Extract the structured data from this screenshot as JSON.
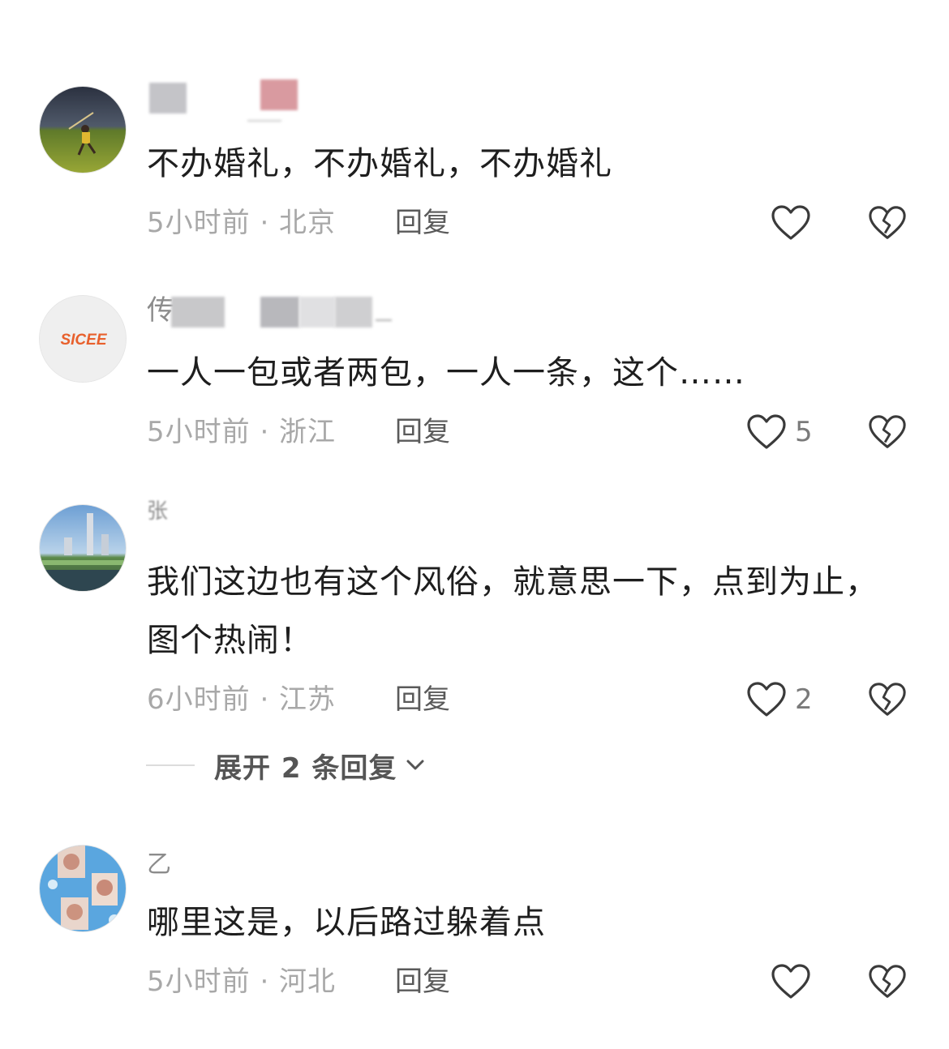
{
  "comments": [
    {
      "username": "",
      "text": "不办婚礼，不办婚礼，不办婚礼",
      "time_location": "5小时前 · 北京",
      "reply_label": "回复",
      "like_count": "",
      "like_icon": "heart-outline-icon",
      "dislike_icon": "broken-heart-icon"
    },
    {
      "username": "传",
      "avatar_text": "SICEE",
      "text": "一人一包或者两包，一人一条，这个……",
      "time_location": "5小时前 · 浙江",
      "reply_label": "回复",
      "like_count": "5",
      "like_icon": "heart-outline-icon",
      "dislike_icon": "broken-heart-icon"
    },
    {
      "username": "张",
      "text": "我们这边也有这个风俗，就意思一下，点到为止，图个热闹！",
      "time_location": "6小时前 · 江苏",
      "reply_label": "回复",
      "like_count": "2",
      "like_icon": "heart-outline-icon",
      "dislike_icon": "broken-heart-icon",
      "expand_label": "展开 2 条回复",
      "expand_icon": "chevron-down-icon"
    },
    {
      "username": "乙",
      "text": "哪里这是，以后路过躲着点",
      "time_location": "5小时前 · 河北",
      "reply_label": "回复",
      "like_count": "",
      "like_icon": "heart-outline-icon",
      "dislike_icon": "broken-heart-icon"
    }
  ],
  "colors": {
    "text_primary": "#1e1e1e",
    "text_meta": "#a8a8a8",
    "reply": "#5a5a5a",
    "icon": "#3a3a3a",
    "accent_logo": "#e8602c"
  }
}
